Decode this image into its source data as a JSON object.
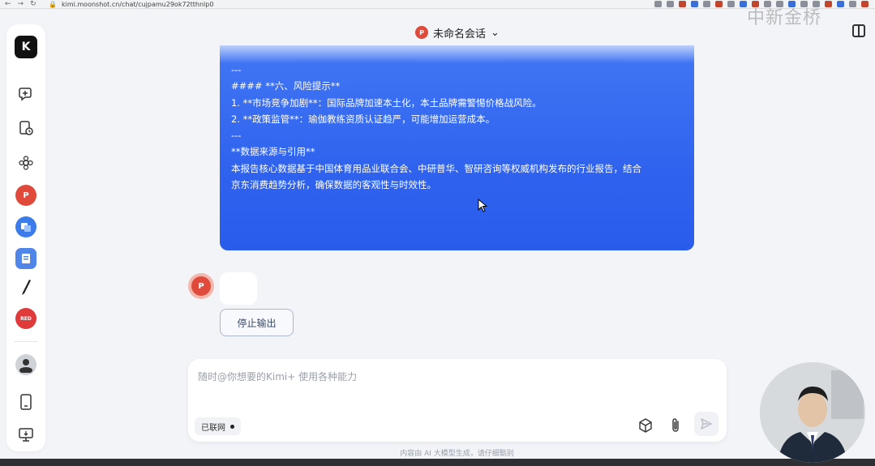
{
  "browser": {
    "url": "kimi.moonshot.cn/chat/cujpamu29ok72tthnlp0"
  },
  "watermark": "中新金桥",
  "header": {
    "title": "未命名会话",
    "badge": "P"
  },
  "sidebar": {
    "logo": "K",
    "items": [
      {
        "name": "new-chat-icon"
      },
      {
        "name": "history-icon"
      },
      {
        "name": "explore-icon"
      },
      {
        "name": "ppt-assistant-icon",
        "label": "P",
        "color": "#e04a3a"
      },
      {
        "name": "translate-assistant-icon",
        "color": "#3b7bea"
      },
      {
        "name": "document-assistant-icon",
        "color": "#4f86e8"
      },
      {
        "name": "pen-assistant-icon"
      },
      {
        "name": "red-assistant-icon",
        "label": "RED",
        "color": "#e03a3a"
      },
      {
        "name": "user-avatar-icon"
      },
      {
        "name": "mobile-app-icon"
      },
      {
        "name": "desktop-download-icon"
      }
    ]
  },
  "message": {
    "lines": [
      "---",
      "",
      "#### **六、风险提示**",
      "1. **市场竞争加剧**：国际品牌加速本土化，本土品牌需警惕价格战风险。",
      "2. **政策监管**：瑜伽教练资质认证趋严，可能增加运营成本。",
      "",
      "---",
      "",
      "**数据来源与引用**",
      "本报告核心数据基于中国体育用品业联合会、中研普华、智研咨询等权威机构发布的行业报告，结合",
      "京东消费趋势分析，确保数据的客观性与时效性。"
    ]
  },
  "assistant": {
    "avatar_label": "P"
  },
  "actions": {
    "stop_label": "停止输出"
  },
  "input": {
    "placeholder": "随时@你想要的Kimi+ 使用各种能力",
    "value": "",
    "network_label": "已联网"
  },
  "footer": {
    "note": "内容由 AI 大模型生成，请仔细甄别"
  }
}
